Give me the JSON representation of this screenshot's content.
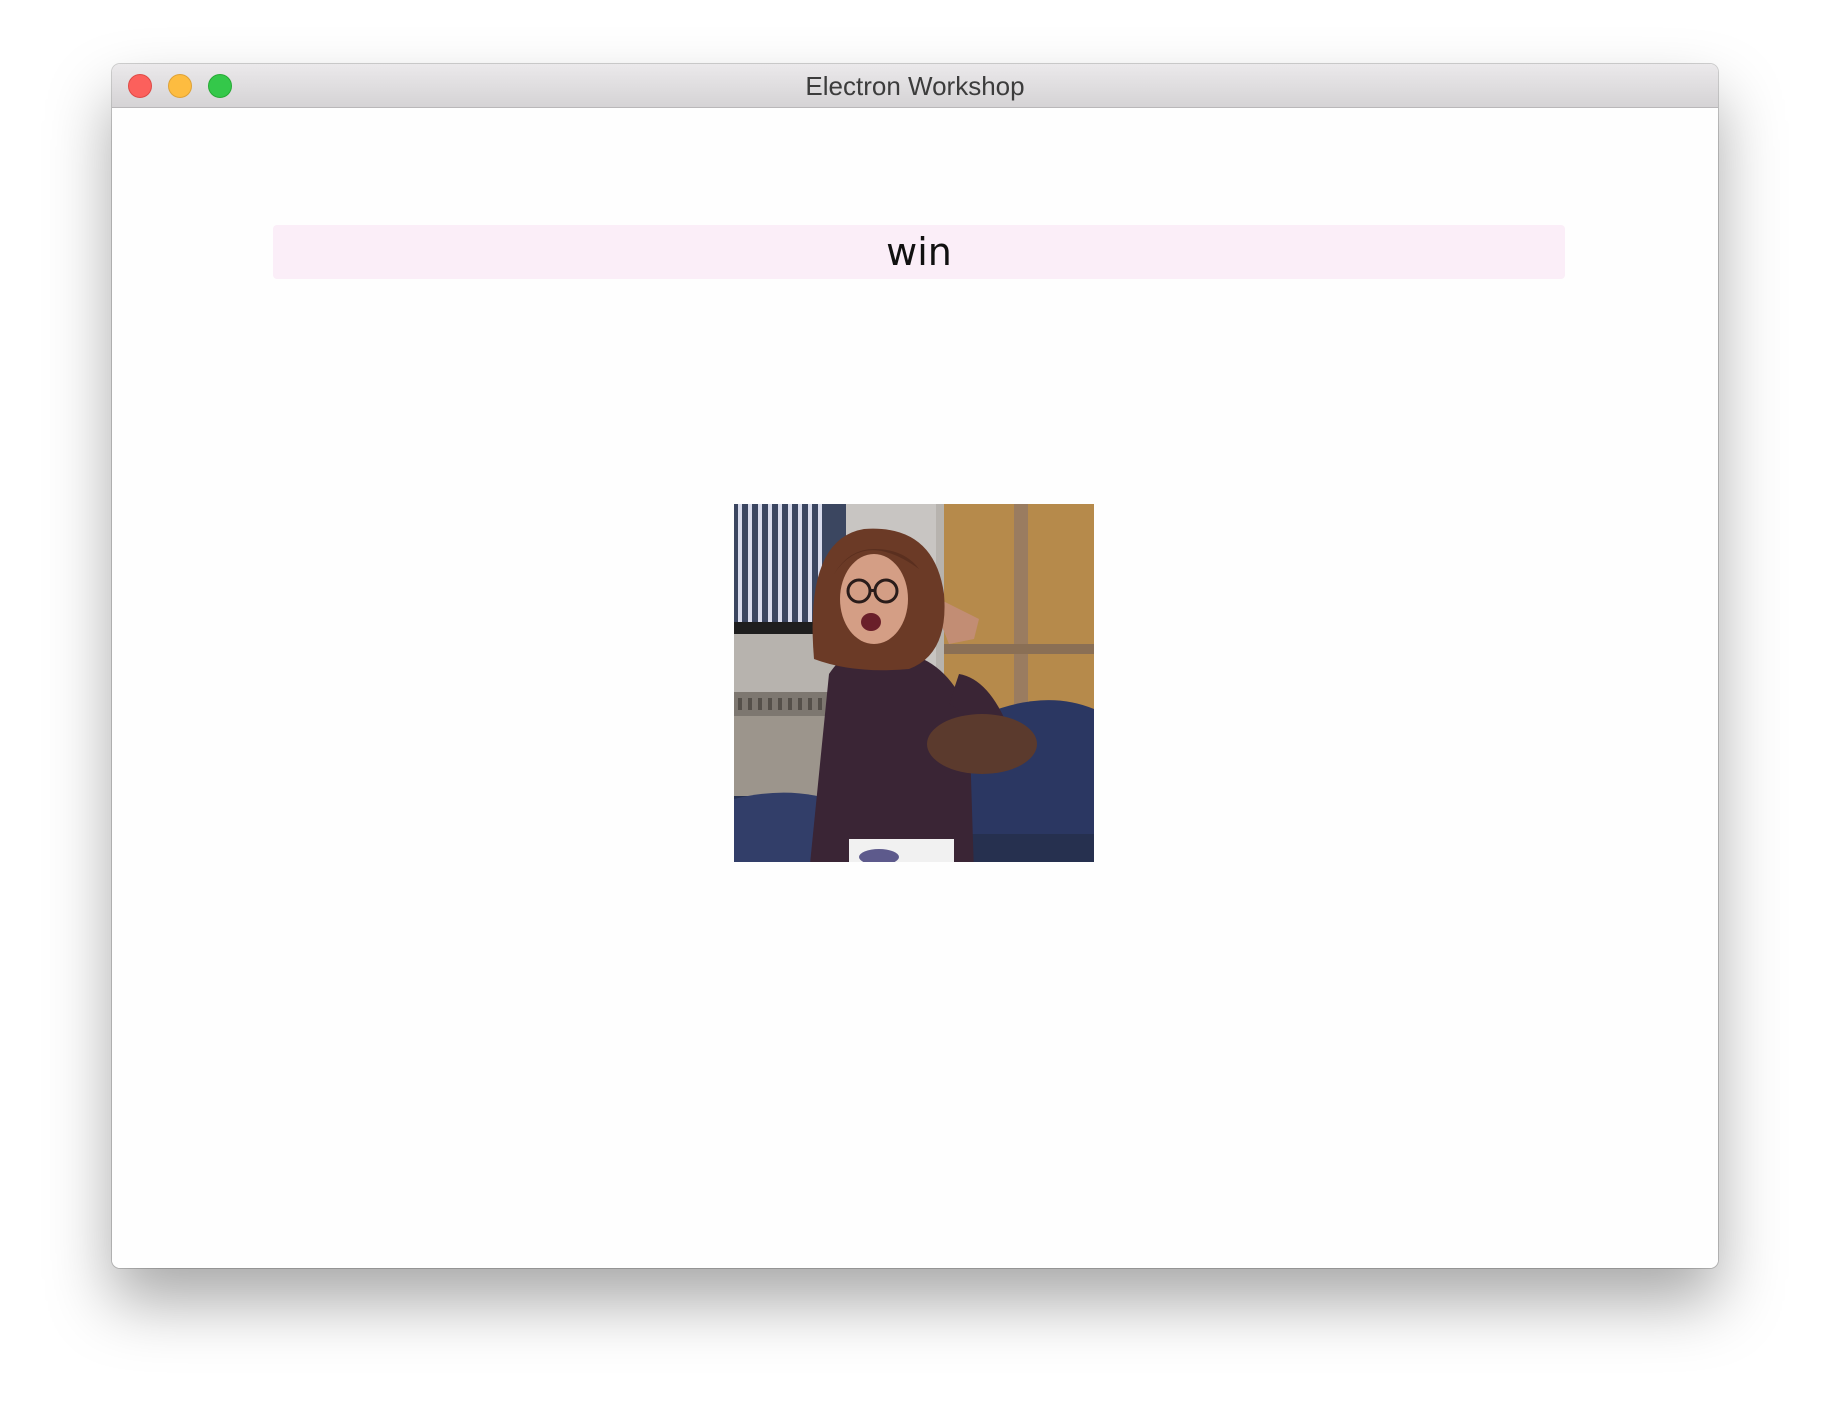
{
  "window": {
    "title": "Electron Workshop"
  },
  "search": {
    "value": "win",
    "background": "#fbeef8"
  },
  "result": {
    "icon": "animated-gif-image"
  },
  "colors": {
    "close": "#fc605c",
    "minimize": "#fdbc40",
    "maximize": "#34c84a"
  }
}
